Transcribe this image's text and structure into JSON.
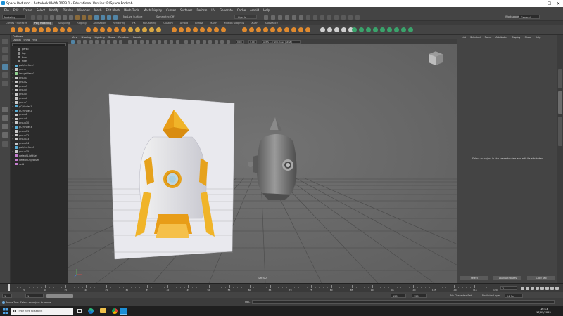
{
  "window": {
    "title": "Space Pod.mb* - Autodesk MAYA 2023.1 - Educational Version: F:\\Space Pod.mb",
    "minimize": "—",
    "maximize": "☐",
    "close": "✕"
  },
  "menus": [
    "File",
    "Edit",
    "Create",
    "Select",
    "Modify",
    "Display",
    "Windows",
    "Mesh",
    "Edit Mesh",
    "Mesh Tools",
    "Mesh Display",
    "Curves",
    "Surfaces",
    "Deform",
    "UV",
    "Generate",
    "Cache",
    "Arnold",
    "Help"
  ],
  "statusline": {
    "menuset": "Modeling",
    "live_surface": "No Live Surface",
    "symmetry": "Symmetry: Off",
    "sign_in": "Sign In",
    "workspace_label": "Workspace:",
    "workspace_value": "General"
  },
  "shelf_tabs": [
    "Curves / Surfaces",
    "Poly Modeling",
    "Sculpting",
    "Rigging",
    "Animation",
    "Rendering",
    "FX",
    "FX Caching",
    "Custom",
    "Arnold",
    "Bifrost",
    "MASH",
    "Motion Graphics",
    "XGen",
    "Substance"
  ],
  "shelf_active": 1,
  "outliner": {
    "title": "Outliner",
    "menus": [
      "Display",
      "Show",
      "Help"
    ],
    "items": [
      {
        "label": "persp",
        "icon": "camera",
        "depth": 1,
        "expand": ""
      },
      {
        "label": "top",
        "icon": "camera",
        "depth": 1,
        "expand": ""
      },
      {
        "label": "front",
        "icon": "camera",
        "depth": 1,
        "expand": ""
      },
      {
        "label": "side",
        "icon": "camera",
        "depth": 1,
        "expand": ""
      },
      {
        "label": "polySurface1",
        "icon": "mesh",
        "depth": 0,
        "expand": "+"
      },
      {
        "label": "group",
        "icon": "group",
        "depth": 0,
        "expand": "+"
      },
      {
        "label": "imagePlane1",
        "icon": "image",
        "depth": 0,
        "expand": "+"
      },
      {
        "label": "group1",
        "icon": "group",
        "depth": 0,
        "expand": "+"
      },
      {
        "label": "group2",
        "icon": "group",
        "depth": 0,
        "expand": "+"
      },
      {
        "label": "group3",
        "icon": "group",
        "depth": 0,
        "expand": "+"
      },
      {
        "label": "group4",
        "icon": "group",
        "depth": 0,
        "expand": "+"
      },
      {
        "label": "group5",
        "icon": "group",
        "depth": 0,
        "expand": "+"
      },
      {
        "label": "group6",
        "icon": "group",
        "depth": 0,
        "expand": "+"
      },
      {
        "label": "group7",
        "icon": "group",
        "depth": 0,
        "expand": "+"
      },
      {
        "label": "pCylinder1",
        "icon": "mesh",
        "depth": 0,
        "expand": "+"
      },
      {
        "label": "pCylinder2",
        "icon": "mesh",
        "depth": 0,
        "expand": "+"
      },
      {
        "label": "group8",
        "icon": "group",
        "depth": 0,
        "expand": "+"
      },
      {
        "label": "group9",
        "icon": "group",
        "depth": 0,
        "expand": "+"
      },
      {
        "label": "group10",
        "icon": "group",
        "depth": 0,
        "expand": "+"
      },
      {
        "label": "pCylinder3",
        "icon": "mesh",
        "depth": 0,
        "expand": "+"
      },
      {
        "label": "group11",
        "icon": "group",
        "depth": 0,
        "expand": "+"
      },
      {
        "label": "group12",
        "icon": "group",
        "depth": 0,
        "expand": "+"
      },
      {
        "label": "group13",
        "icon": "group",
        "depth": 0,
        "expand": "+"
      },
      {
        "label": "group14",
        "icon": "group",
        "depth": 0,
        "expand": "+"
      },
      {
        "label": "polySurface2",
        "icon": "mesh",
        "depth": 0,
        "expand": "+"
      },
      {
        "label": "group15",
        "icon": "group",
        "depth": 0,
        "expand": "+"
      },
      {
        "label": "defaultLightSet",
        "icon": "set",
        "depth": 0,
        "expand": ""
      },
      {
        "label": "defaultObjectSet",
        "icon": "set",
        "depth": 0,
        "expand": ""
      },
      {
        "label": "set1",
        "icon": "set",
        "depth": 0,
        "expand": ""
      }
    ]
  },
  "viewport": {
    "menus": [
      "View",
      "Shading",
      "Lighting",
      "Show",
      "Renderer",
      "Panels"
    ],
    "camera_label": "persp",
    "near_value": "0.00",
    "far_value": "1.00",
    "color_space": "ACES 1.0 SDR-video (sRGB)"
  },
  "attribute_editor": {
    "menus": [
      "List",
      "Selected",
      "Focus",
      "Attributes",
      "Display",
      "Show",
      "Help"
    ],
    "message": "Select an object in the scene to view and edit its attributes.",
    "select_button": "Select",
    "load_button": "Load Attributes",
    "copy_button": "Copy Tab"
  },
  "side_tabs": [
    "Modeling Toolkit",
    "Attribute Editor",
    "Channel Box / Layer Editor"
  ],
  "timeline": {
    "ticks": [
      "5",
      "10",
      "15",
      "20",
      "25",
      "30",
      "35",
      "40",
      "45",
      "50",
      "55",
      "60",
      "65",
      "70",
      "75",
      "80",
      "85",
      "90",
      "95",
      "100",
      "105",
      "110",
      "115",
      "120"
    ],
    "current_frame": "1",
    "range_start": "1",
    "range_start_inner": "1",
    "range_end_inner": "120",
    "range_end": "120",
    "range_max": "200",
    "fps": "24 fps",
    "character_set": "No Character Set",
    "anim_layer": "No Anim Layer"
  },
  "command_line": {
    "lang": "MEL",
    "help_text": "Move Tool: Select an object to move."
  },
  "taskbar": {
    "search_placeholder": "Type here to search",
    "time": "16:13",
    "date": "17/05/2023"
  },
  "colors": {
    "accent_blue": "#5285a6",
    "maya_teal": "#1c8fd6",
    "gold": "#e6a21c",
    "viewport_bg": "#6b6b6b"
  }
}
